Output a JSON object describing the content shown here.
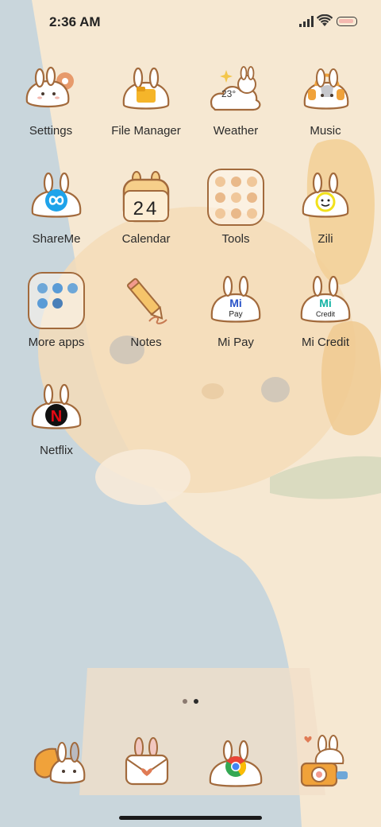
{
  "status_bar": {
    "time": "2:36 AM",
    "icons": [
      "signal-icon",
      "wifi-icon",
      "battery-icon"
    ]
  },
  "apps": [
    {
      "label": "Settings",
      "icon": "settings-icon"
    },
    {
      "label": "File Manager",
      "icon": "file-manager-icon"
    },
    {
      "label": "Weather",
      "icon": "weather-icon",
      "temp_text": "23°"
    },
    {
      "label": "Music",
      "icon": "music-icon"
    },
    {
      "label": "ShareMe",
      "icon": "shareme-icon"
    },
    {
      "label": "Calendar",
      "icon": "calendar-icon",
      "date_text": "24"
    },
    {
      "label": "Tools",
      "icon": "tools-folder-icon"
    },
    {
      "label": "Zili",
      "icon": "zili-icon"
    },
    {
      "label": "More apps",
      "icon": "more-apps-folder-icon"
    },
    {
      "label": "Notes",
      "icon": "notes-icon"
    },
    {
      "label": "Mi Pay",
      "icon": "mi-pay-icon",
      "logo_text": [
        "Mi",
        "Pay"
      ]
    },
    {
      "label": "Mi Credit",
      "icon": "mi-credit-icon",
      "logo_text": [
        "Mi",
        "Credit"
      ]
    },
    {
      "label": "Netflix",
      "icon": "netflix-icon",
      "logo_text": "N"
    }
  ],
  "page_indicator": {
    "pages": 2,
    "current": 2
  },
  "dock": [
    {
      "icon": "phone-icon"
    },
    {
      "icon": "messages-icon"
    },
    {
      "icon": "chrome-icon"
    },
    {
      "icon": "camera-icon"
    }
  ],
  "colors": {
    "wall_cream": "#f6e8d2",
    "wall_blue": "#c9d6dc",
    "bunny_outline": "#a26a3c",
    "label": "#2b2b2b",
    "netflix_red": "#e50914",
    "shareme_blue": "#1fa3ea",
    "mi_teal": "#13b3a4"
  }
}
